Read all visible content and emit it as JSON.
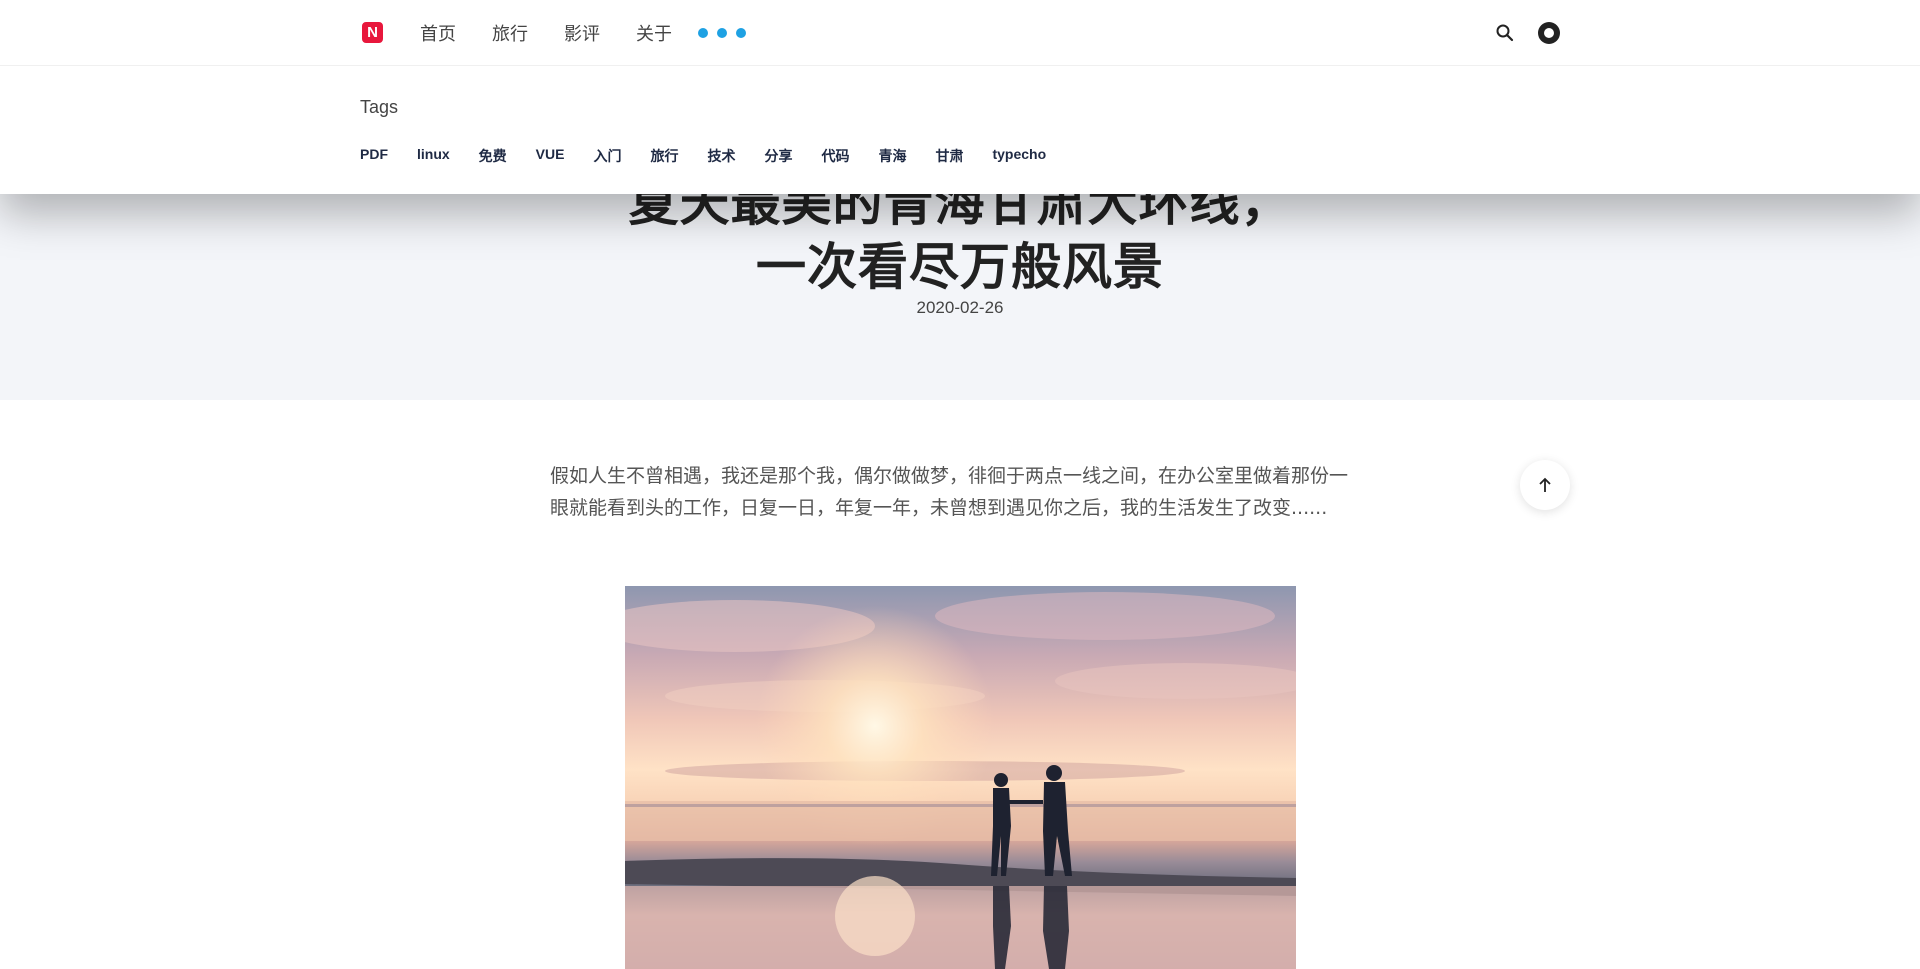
{
  "nav": {
    "logo_letter": "N",
    "items": [
      "首页",
      "旅行",
      "影评",
      "关于"
    ],
    "accent": "#1ea1e3",
    "brand": "#e8173c"
  },
  "tags": {
    "title": "Tags",
    "items": [
      "PDF",
      "linux",
      "免费",
      "VUE",
      "入门",
      "旅行",
      "技术",
      "分享",
      "代码",
      "青海",
      "甘肃",
      "typecho"
    ]
  },
  "post": {
    "title_line1": "夏天最美的青海甘肃大环线，",
    "title_line2": "一次看尽万般风景",
    "date": "2020-02-26",
    "excerpt": "假如人生不曾相遇，我还是那个我，偶尔做做梦，徘徊于两点一线之间，在办公室里做着那份一眼就能看到头的工作，日复一日，年复一年，未曾想到遇见你之后，我的生活发生了改变......"
  },
  "icons": {
    "search": "search-icon",
    "theme": "theme-toggle-icon",
    "back_to_top": "arrow-up-icon",
    "more": "more-dots-icon"
  }
}
